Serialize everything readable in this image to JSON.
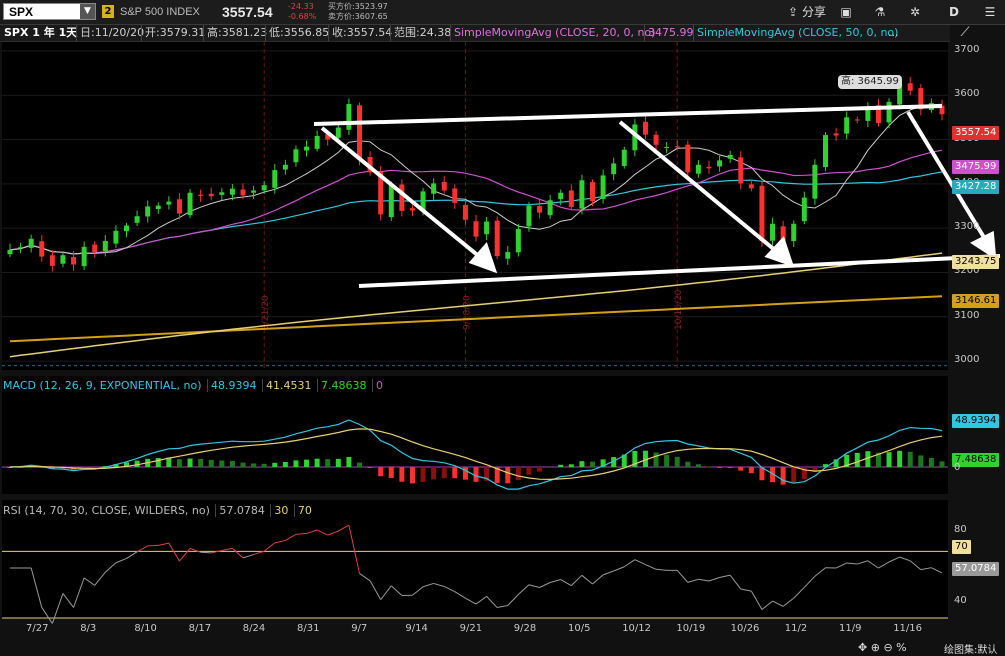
{
  "toolbar": {
    "symbol": "SPX",
    "link_badge": "2",
    "symbol_name": "S&P 500 INDEX",
    "last": "3557.54",
    "change": "-24.33",
    "change_pct": "-0.68%",
    "bid": "买方价:3523.97",
    "ask": "卖方价:3607.65",
    "share_label": "分享",
    "right_letter": "D"
  },
  "info": {
    "title": "SPX 1 年 1天",
    "date": "日:11/20/20",
    "open": "开:3579.31",
    "high": "高:3581.23",
    "low": "低:3556.85",
    "close": "收:3557.54",
    "range": "范围:24.38",
    "sma20_label": "SimpleMovingAvg (CLOSE, 20, 0, no)",
    "sma20_value": "3475.99",
    "sma50_label": "SimpleMovingAvg (CLOSE, 50, 0, no)",
    "more": "..."
  },
  "price_axis": {
    "ticks": [
      "3700",
      "3600",
      "3500",
      "3400",
      "3300",
      "3200",
      "3100",
      "3000"
    ],
    "last_tag": "3557.54",
    "sma20_tag": "3475.99",
    "sma50_tag": "3427.28",
    "sma100_tag": "3243.75",
    "sma200_tag": "3146.61",
    "high_tag": "高: 3645.99"
  },
  "date_axis": {
    "labels": [
      "7/27",
      "8/3",
      "8/10",
      "8/17",
      "8/24",
      "8/31",
      "9/7",
      "9/14",
      "9/21",
      "9/28",
      "10/5",
      "10/12",
      "10/19",
      "10/26",
      "11/2",
      "11/9",
      "11/16"
    ],
    "event_markers": [
      "8/21/20",
      "9/18/20",
      "10/16/20"
    ]
  },
  "macd": {
    "label": "MACD (12, 26, 9, EXPONENTIAL, no)",
    "value": "48.9394",
    "avg": "41.4531",
    "diff": "7.48638",
    "zero": "0",
    "axis_value_tag": "48.9394",
    "axis_diff_tag": "7.48638",
    "axis_zero": "0"
  },
  "rsi": {
    "label": "RSI (14, 70, 30, CLOSE, WILDERS, no)",
    "value": "57.0784",
    "ob": "30",
    "os": "70",
    "axis_ticks": [
      "80",
      "40"
    ],
    "axis_70": "70",
    "axis_value_tag": "57.0784"
  },
  "footer": {
    "drawing_set": "绘图集:默认"
  },
  "colors": {
    "up": "#2fd22f",
    "down": "#ff3030",
    "sma20": "#d050d0",
    "sma50": "#30c8e0",
    "sma100": "#e8d070",
    "sma200": "#d4a017",
    "bb": "#cccccc"
  },
  "chart_data": {
    "type": "candlestick",
    "title": "SPX 1 年 1天",
    "x": [
      "7/20",
      "7/21",
      "7/22",
      "7/23",
      "7/24",
      "7/27",
      "7/28",
      "7/29",
      "7/30",
      "7/31",
      "8/3",
      "8/4",
      "8/5",
      "8/6",
      "8/7",
      "8/10",
      "8/11",
      "8/12",
      "8/13",
      "8/14",
      "8/17",
      "8/18",
      "8/19",
      "8/20",
      "8/21",
      "8/24",
      "8/25",
      "8/26",
      "8/27",
      "8/28",
      "8/31",
      "9/1",
      "9/2",
      "9/3",
      "9/4",
      "9/8",
      "9/9",
      "9/10",
      "9/11",
      "9/14",
      "9/15",
      "9/16",
      "9/17",
      "9/18",
      "9/21",
      "9/22",
      "9/23",
      "9/24",
      "9/25",
      "9/28",
      "9/29",
      "9/30",
      "10/1",
      "10/2",
      "10/5",
      "10/6",
      "10/7",
      "10/8",
      "10/9",
      "10/12",
      "10/13",
      "10/14",
      "10/15",
      "10/16",
      "10/19",
      "10/20",
      "10/21",
      "10/22",
      "10/23",
      "10/26",
      "10/27",
      "10/28",
      "10/29",
      "10/30",
      "11/2",
      "11/3",
      "11/4",
      "11/5",
      "11/6",
      "11/9",
      "11/10",
      "11/11",
      "11/12",
      "11/13",
      "11/16",
      "11/17",
      "11/18",
      "11/19",
      "11/20"
    ],
    "close": [
      3251,
      3257,
      3276,
      3236,
      3215,
      3239,
      3218,
      3258,
      3246,
      3271,
      3294,
      3306,
      3327,
      3349,
      3351,
      3360,
      3333,
      3380,
      3373,
      3372,
      3381,
      3389,
      3374,
      3385,
      3397,
      3431,
      3443,
      3478,
      3484,
      3508,
      3500,
      3527,
      3580,
      3455,
      3426,
      3331,
      3398,
      3339,
      3340,
      3383,
      3401,
      3385,
      3357,
      3319,
      3281,
      3315,
      3237,
      3246,
      3298,
      3351,
      3335,
      3363,
      3380,
      3348,
      3408,
      3361,
      3419,
      3446,
      3477,
      3534,
      3511,
      3488,
      3483,
      3483,
      3426,
      3443,
      3435,
      3453,
      3465,
      3401,
      3390,
      3271,
      3310,
      3270,
      3310,
      3369,
      3443,
      3510,
      3509,
      3550,
      3545,
      3572,
      3537,
      3585,
      3627,
      3610,
      3568,
      3582,
      3557
    ],
    "ylim": [
      2980,
      3720
    ],
    "high_annotation": 3645.99,
    "series": [
      {
        "name": "SimpleMovingAvg (CLOSE, 20, 0, no)",
        "last": 3475.99
      },
      {
        "name": "SimpleMovingAvg (CLOSE, 50, 0, no)",
        "last": 3427.28
      }
    ],
    "macd": {
      "value": 48.9394,
      "avg": 41.4531,
      "diff": 7.48638
    },
    "rsi": {
      "value": 57.0784,
      "overbought": 70,
      "oversold": 30
    }
  }
}
